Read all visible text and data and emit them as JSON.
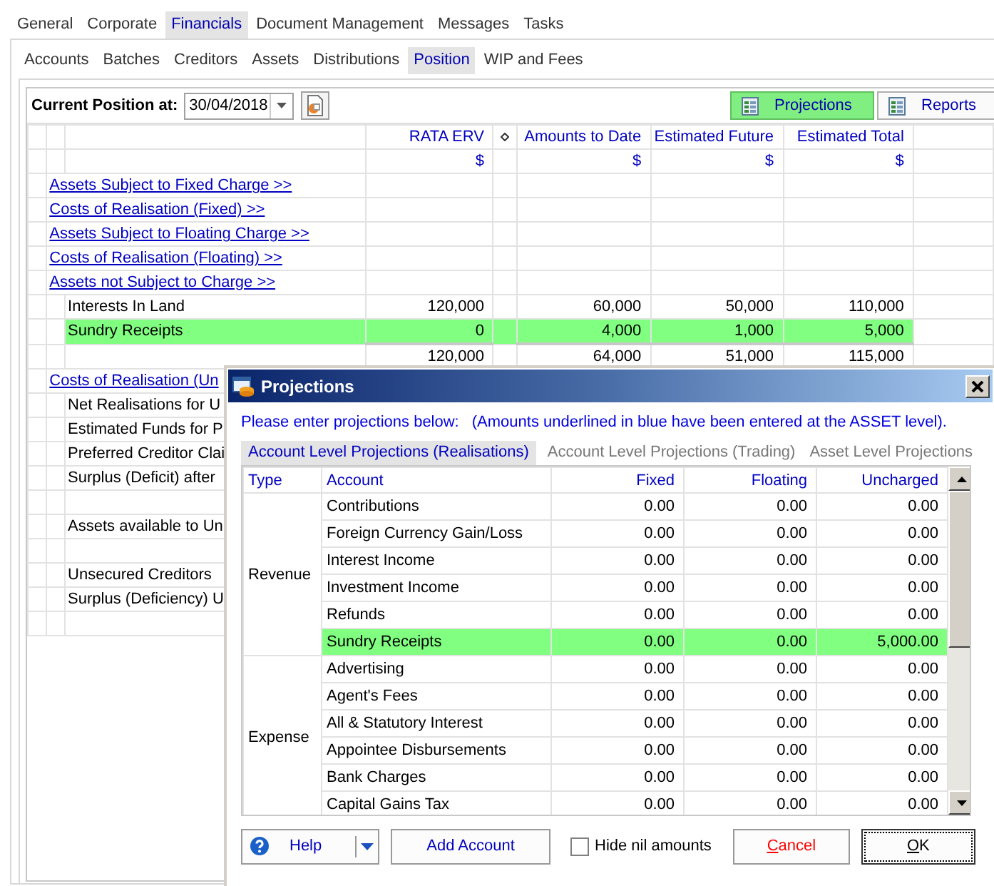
{
  "main_tabs": [
    {
      "label": "General",
      "selected": false
    },
    {
      "label": "Corporate",
      "selected": false
    },
    {
      "label": "Financials",
      "selected": true
    },
    {
      "label": "Document Management",
      "selected": false
    },
    {
      "label": "Messages",
      "selected": false
    },
    {
      "label": "Tasks",
      "selected": false
    }
  ],
  "sub_tabs": [
    {
      "label": "Accounts",
      "selected": false
    },
    {
      "label": "Batches",
      "selected": false
    },
    {
      "label": "Creditors",
      "selected": false
    },
    {
      "label": "Assets",
      "selected": false
    },
    {
      "label": "Distributions",
      "selected": false
    },
    {
      "label": "Position",
      "selected": true
    },
    {
      "label": "WIP and Fees",
      "selected": false
    }
  ],
  "toolbar": {
    "label": "Current Position at:",
    "date": "30/04/2018",
    "buttons": [
      {
        "label": "Projections",
        "selected": true
      },
      {
        "label": "Reports",
        "selected": false
      }
    ]
  },
  "position_grid": {
    "columns": [
      {
        "label": "RATA ERV",
        "unit": "$"
      },
      {
        "label": "Amounts to Date",
        "unit": "$"
      },
      {
        "label": "Estimated Future",
        "unit": "$"
      },
      {
        "label": "Estimated Total",
        "unit": "$"
      }
    ],
    "rows": [
      {
        "kind": "link",
        "label": "Assets Subject to Fixed Charge  >>"
      },
      {
        "kind": "link",
        "label": "Costs of Realisation (Fixed)  >>"
      },
      {
        "kind": "link",
        "label": "Assets Subject to Floating Charge  >>"
      },
      {
        "kind": "link",
        "label": "Costs of Realisation (Floating)  >>"
      },
      {
        "kind": "link",
        "label": "Assets not Subject to Charge  >>"
      },
      {
        "kind": "item",
        "label": "Interests In Land",
        "values": [
          "120,000",
          "60,000",
          "50,000",
          "110,000"
        ],
        "highlighted": false
      },
      {
        "kind": "item",
        "label": "Sundry Receipts",
        "values": [
          "0",
          "4,000",
          "1,000",
          "5,000"
        ],
        "highlighted": true
      },
      {
        "kind": "total",
        "values": [
          "120,000",
          "64,000",
          "51,000",
          "115,000"
        ]
      },
      {
        "kind": "link",
        "label": "Costs of Realisation (Un"
      },
      {
        "kind": "item",
        "label": "Net Realisations for U",
        "highlighted": false
      },
      {
        "kind": "item",
        "label": "Estimated Funds for P",
        "highlighted": false
      },
      {
        "kind": "item",
        "label": "Preferred Creditor Clai",
        "highlighted": false
      },
      {
        "kind": "item",
        "label": "Surplus (Deficit) after",
        "highlighted": false
      },
      {
        "kind": "blank"
      },
      {
        "kind": "item",
        "label": "Assets available to Un",
        "highlighted": false
      },
      {
        "kind": "blank"
      },
      {
        "kind": "item",
        "label": "Unsecured Creditors",
        "highlighted": false
      },
      {
        "kind": "item",
        "label": "Surplus (Deficiency) U",
        "highlighted": false
      },
      {
        "kind": "blank"
      }
    ]
  },
  "dialog": {
    "title": "Projections",
    "instruction": "Please enter projections below:",
    "note": "(Amounts underlined in blue have been entered at the ASSET level).",
    "tabs": [
      {
        "label": "Account Level Projections (Realisations)",
        "selected": true
      },
      {
        "label": "Account Level Projections (Trading)",
        "selected": false
      },
      {
        "label": "Asset Level Projections",
        "selected": false
      }
    ],
    "columns": [
      "Type",
      "Account",
      "Fixed",
      "Floating",
      "Uncharged"
    ],
    "groups": [
      {
        "type": "Revenue",
        "rows": [
          {
            "account": "Contributions",
            "fixed": "0.00",
            "floating": "0.00",
            "uncharged": "0.00",
            "highlighted": false
          },
          {
            "account": "Foreign Currency Gain/Loss",
            "fixed": "0.00",
            "floating": "0.00",
            "uncharged": "0.00",
            "highlighted": false
          },
          {
            "account": "Interest Income",
            "fixed": "0.00",
            "floating": "0.00",
            "uncharged": "0.00",
            "highlighted": false
          },
          {
            "account": "Investment Income",
            "fixed": "0.00",
            "floating": "0.00",
            "uncharged": "0.00",
            "highlighted": false
          },
          {
            "account": "Refunds",
            "fixed": "0.00",
            "floating": "0.00",
            "uncharged": "0.00",
            "highlighted": false
          },
          {
            "account": "Sundry Receipts",
            "fixed": "0.00",
            "floating": "0.00",
            "uncharged": "5,000.00",
            "highlighted": true
          }
        ]
      },
      {
        "type": "Expense",
        "rows": [
          {
            "account": "Advertising",
            "fixed": "0.00",
            "floating": "0.00",
            "uncharged": "0.00",
            "highlighted": false
          },
          {
            "account": "Agent's Fees",
            "fixed": "0.00",
            "floating": "0.00",
            "uncharged": "0.00",
            "highlighted": false
          },
          {
            "account": "All & Statutory Interest",
            "fixed": "0.00",
            "floating": "0.00",
            "uncharged": "0.00",
            "highlighted": false
          },
          {
            "account": "Appointee Disbursements",
            "fixed": "0.00",
            "floating": "0.00",
            "uncharged": "0.00",
            "highlighted": false
          },
          {
            "account": "Bank Charges",
            "fixed": "0.00",
            "floating": "0.00",
            "uncharged": "0.00",
            "highlighted": false
          },
          {
            "account": "Capital Gains Tax",
            "fixed": "0.00",
            "floating": "0.00",
            "uncharged": "0.00",
            "highlighted": false
          }
        ]
      }
    ],
    "buttons": [
      {
        "kind": "split",
        "label": "Help"
      },
      {
        "kind": "plain",
        "label": "Add Account"
      },
      {
        "kind": "checkbox",
        "label": "Hide nil amounts",
        "checked": false
      },
      {
        "kind": "cancel",
        "label": "Cancel"
      },
      {
        "kind": "default",
        "label": "OK"
      }
    ]
  }
}
